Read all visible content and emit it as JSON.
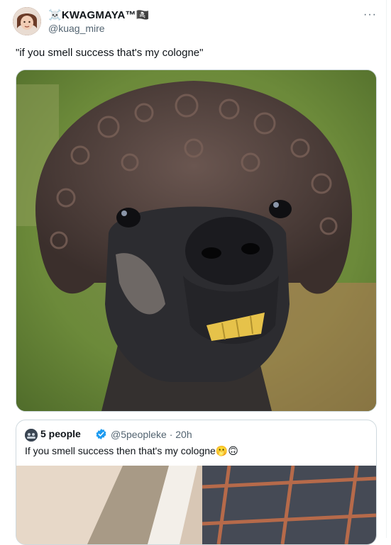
{
  "tweet": {
    "display_name": "☠️KWAGMAYA™🏴‍☠️",
    "handle": "@kuag_mire",
    "more_label": "···",
    "text": "\"if you smell success that's my cologne\"",
    "media_alt": "Close-up photo of a dark alpaca with curly hair and buck teeth"
  },
  "quote": {
    "display_name": "5 people",
    "handle_time": "@5peopleke · 20h",
    "text": "If you smell success then that's my cologne🫢🙃",
    "media_alt": "Photo of a building corner with a window grille"
  },
  "colors": {
    "text_primary": "#0f1419",
    "text_secondary": "#536471",
    "verified": "#1d9bf0",
    "border": "#cfd9de"
  }
}
